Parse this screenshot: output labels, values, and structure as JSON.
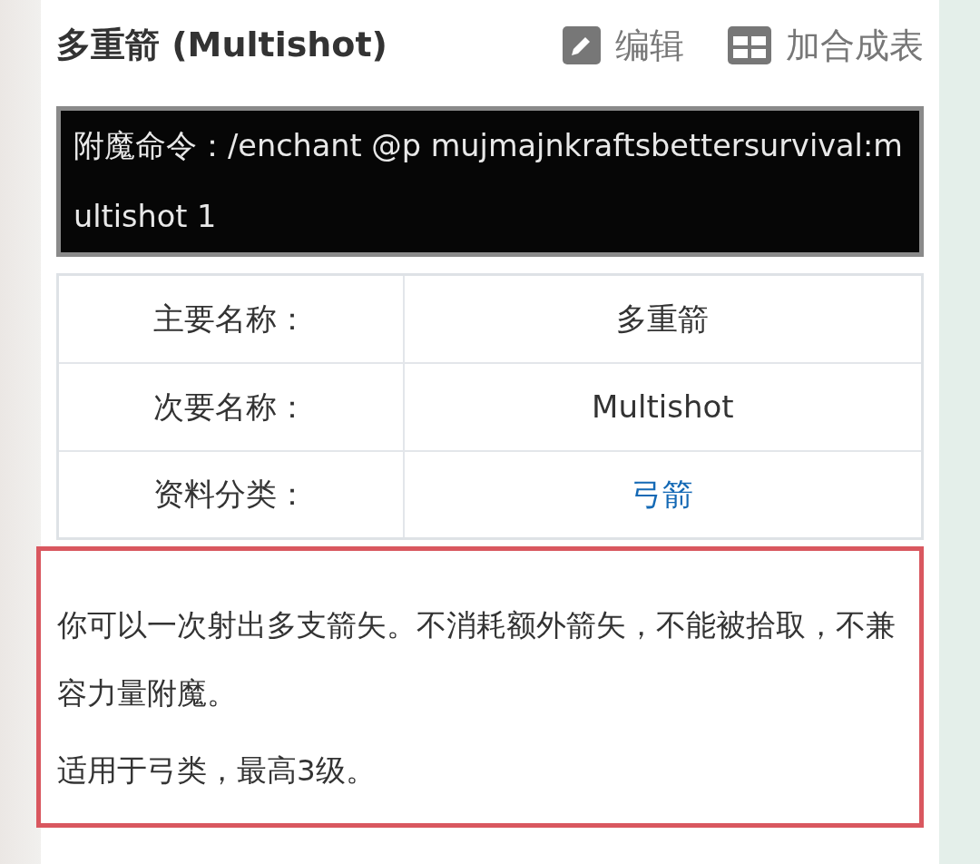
{
  "title": "多重箭 (Multishot)",
  "actions": [
    {
      "kind": "edit",
      "label": "编辑"
    },
    {
      "kind": "table",
      "label": "加合成表"
    }
  ],
  "command": "附魔命令：/enchant @p mujmajnkraftsbettersurvival:multishot 1",
  "info_rows": [
    {
      "label": "主要名称：",
      "value": "多重箭",
      "link": false
    },
    {
      "label": "次要名称：",
      "value": "Multishot",
      "link": false
    },
    {
      "label": "资料分类：",
      "value": "弓箭",
      "link": true
    }
  ],
  "description": [
    "你可以一次射出多支箭矢。不消耗额外箭矢，不能被拾取，不兼容力量附魔。",
    "适用于弓类，最高3级。"
  ]
}
